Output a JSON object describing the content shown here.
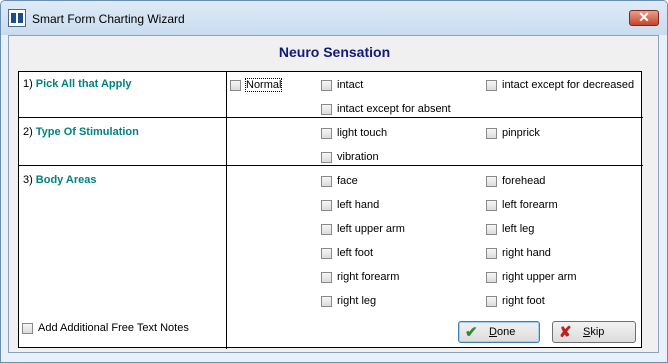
{
  "window": {
    "title": "Smart Form Charting Wizard",
    "heading": "Neuro Sensation"
  },
  "rows": [
    {
      "num": "1)",
      "label": "Pick All that Apply"
    },
    {
      "num": "2)",
      "label": "Type Of Stimulation"
    },
    {
      "num": "3)",
      "label": "Body Areas"
    }
  ],
  "pick_all": {
    "normal": "Normal",
    "intact": "intact",
    "intact_except_decreased": "intact except for decreased",
    "intact_except_absent": "intact except for absent"
  },
  "stimulation": {
    "light_touch": "light touch",
    "pinprick": "pinprick",
    "vibration": "vibration"
  },
  "body_areas": {
    "face": "face",
    "forehead": "forehead",
    "left_hand": "left hand",
    "left_forearm": "left forearm",
    "left_upper_arm": "left upper arm",
    "left_leg": "left leg",
    "left_foot": "left foot",
    "right_hand": "right hand",
    "right_forearm": "right forearm",
    "right_upper_arm": "right upper arm",
    "right_leg": "right leg",
    "right_foot": "right foot"
  },
  "footer": {
    "free_text": "Add Additional Free Text Notes",
    "done_first": "D",
    "done_rest": "one",
    "skip_first": "S",
    "skip_rest": "kip"
  },
  "icons": {
    "done": "checkmark-icon",
    "skip": "x-icon",
    "done_color": "#2e8b2e",
    "skip_color": "#c0201e"
  }
}
